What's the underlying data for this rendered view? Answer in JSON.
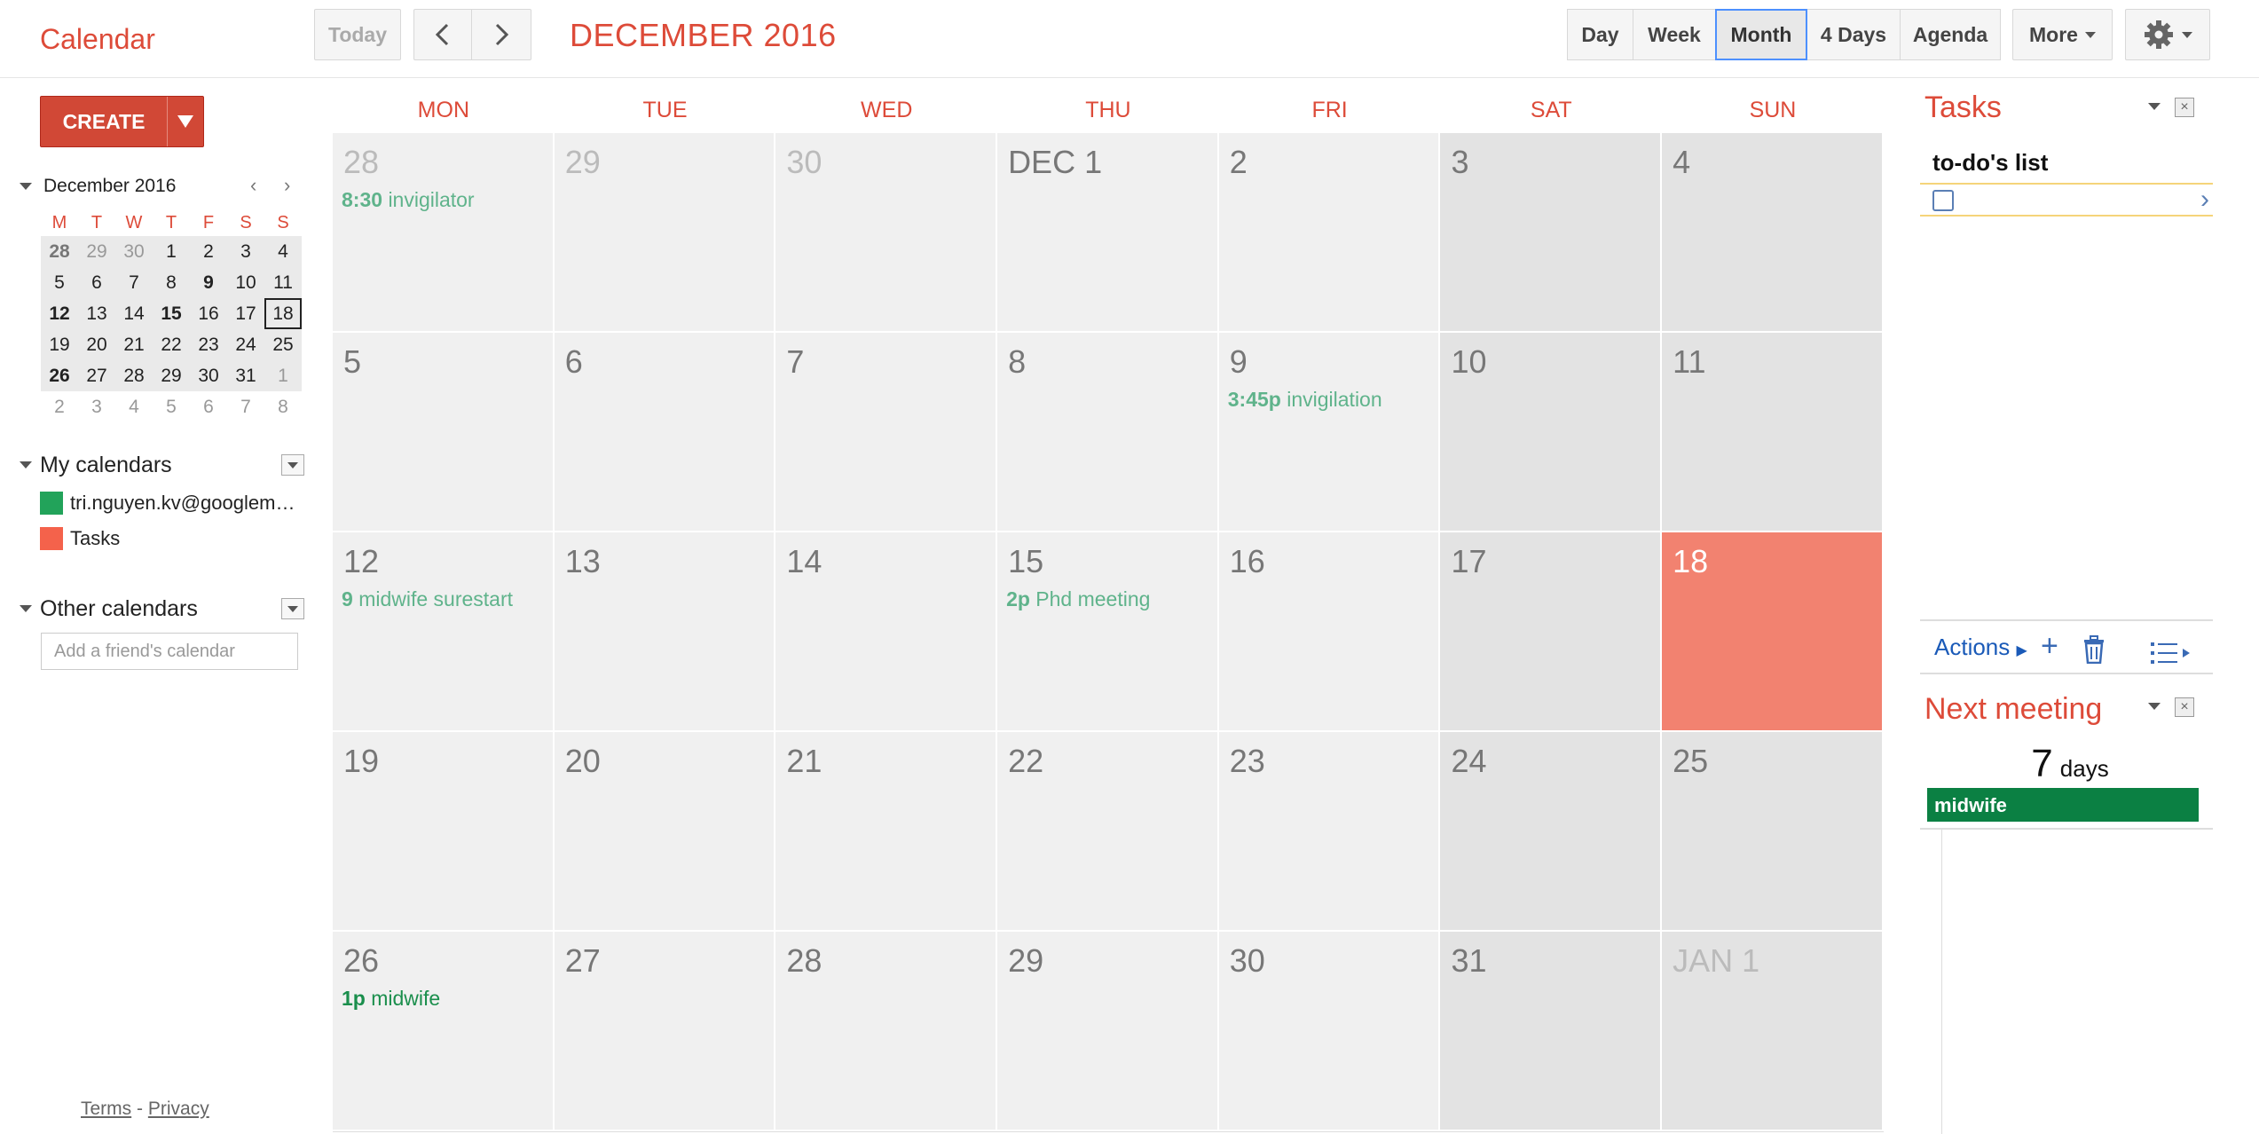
{
  "app": {
    "title": "Calendar"
  },
  "toolbar": {
    "today_label": "Today",
    "period": "DECEMBER 2016",
    "views": [
      {
        "label": "Day",
        "active": false
      },
      {
        "label": "Week",
        "active": false
      },
      {
        "label": "Month",
        "active": true
      },
      {
        "label": "4 Days",
        "active": false
      },
      {
        "label": "Agenda",
        "active": false
      }
    ],
    "more_label": "More"
  },
  "sidebar": {
    "create_label": "CREATE",
    "mini_calendar": {
      "title": "December 2016",
      "weekdays": [
        "M",
        "T",
        "W",
        "T",
        "F",
        "S",
        "S"
      ],
      "weeks": [
        [
          "28",
          "29",
          "30",
          "1",
          "2",
          "3",
          "4"
        ],
        [
          "5",
          "6",
          "7",
          "8",
          "9",
          "10",
          "11"
        ],
        [
          "12",
          "13",
          "14",
          "15",
          "16",
          "17",
          "18"
        ],
        [
          "19",
          "20",
          "21",
          "22",
          "23",
          "24",
          "25"
        ],
        [
          "26",
          "27",
          "28",
          "29",
          "30",
          "31",
          "1"
        ],
        [
          "2",
          "3",
          "4",
          "5",
          "6",
          "7",
          "8"
        ]
      ],
      "today": "18"
    },
    "my_calendars": {
      "label": "My calendars",
      "items": [
        {
          "label": "tri.nguyen.kv@googlem…",
          "color": "#22a35a"
        },
        {
          "label": "Tasks",
          "color": "#f4624b"
        }
      ]
    },
    "other_calendars": {
      "label": "Other calendars",
      "placeholder": "Add a friend's calendar"
    },
    "footer": {
      "terms": "Terms",
      "separator": "-",
      "privacy": "Privacy"
    }
  },
  "month": {
    "weekdays": [
      "MON",
      "TUE",
      "WED",
      "THU",
      "FRI",
      "SAT",
      "SUN"
    ],
    "weeks": [
      [
        {
          "label": "28",
          "other": true,
          "event_time": "8:30",
          "event_title": "invigilator"
        },
        {
          "label": "29",
          "other": true
        },
        {
          "label": "30",
          "other": true
        },
        {
          "label": "DEC 1"
        },
        {
          "label": "2"
        },
        {
          "label": "3"
        },
        {
          "label": "4"
        }
      ],
      [
        {
          "label": "5"
        },
        {
          "label": "6"
        },
        {
          "label": "7"
        },
        {
          "label": "8"
        },
        {
          "label": "9",
          "event_time": "3:45p",
          "event_title": "invigilation"
        },
        {
          "label": "10"
        },
        {
          "label": "11"
        }
      ],
      [
        {
          "label": "12",
          "event_time": "9",
          "event_title": "midwife surestart"
        },
        {
          "label": "13"
        },
        {
          "label": "14"
        },
        {
          "label": "15",
          "event_time": "2p",
          "event_title": "Phd meeting"
        },
        {
          "label": "16"
        },
        {
          "label": "17"
        },
        {
          "label": "18",
          "today": true
        }
      ],
      [
        {
          "label": "19"
        },
        {
          "label": "20"
        },
        {
          "label": "21"
        },
        {
          "label": "22"
        },
        {
          "label": "23"
        },
        {
          "label": "24"
        },
        {
          "label": "25"
        }
      ],
      [
        {
          "label": "26",
          "event_time": "1p",
          "event_title": "midwife",
          "dark": true
        },
        {
          "label": "27"
        },
        {
          "label": "28"
        },
        {
          "label": "29"
        },
        {
          "label": "30"
        },
        {
          "label": "31"
        },
        {
          "label": "JAN 1",
          "other": true
        }
      ]
    ]
  },
  "tasks": {
    "title": "Tasks",
    "list_name": "to-do's list",
    "actions_label": "Actions"
  },
  "next_meeting": {
    "title": "Next meeting",
    "count": "7",
    "unit": "days",
    "event": "midwife"
  },
  "colors": {
    "accent": "#dd4b39",
    "today": "#f28270",
    "event": "#5fb38b",
    "meeting": "#0b8043"
  }
}
